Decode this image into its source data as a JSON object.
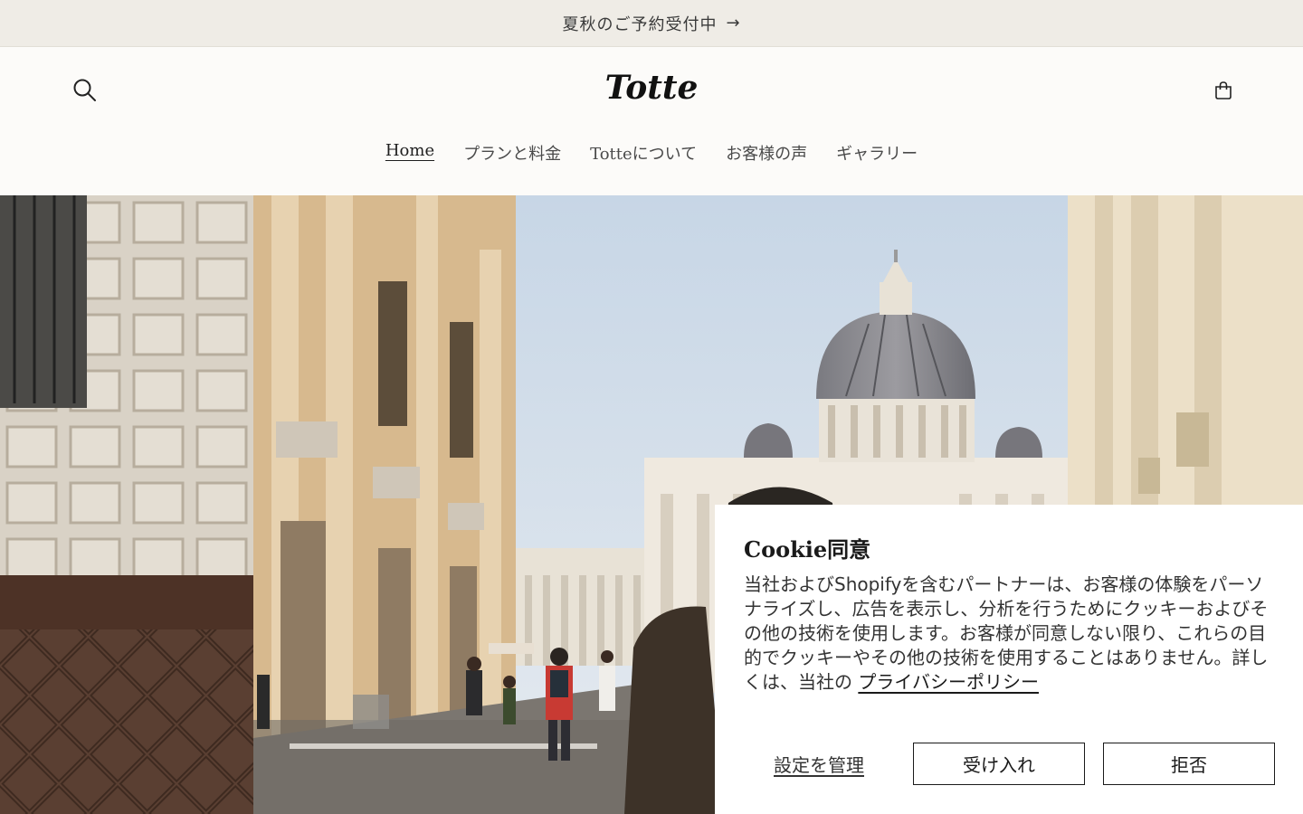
{
  "announcement": {
    "text": "夏秋のご予約受付中",
    "arrow": "→"
  },
  "header": {
    "logo": "Totte",
    "search_icon": "search-icon",
    "cart_icon": "cart-icon"
  },
  "nav": {
    "items": [
      {
        "label": "Home",
        "active": true
      },
      {
        "label": "プランと料金"
      },
      {
        "label": "Totteについて"
      },
      {
        "label": "お客様の声"
      },
      {
        "label": "ギャラリー"
      }
    ]
  },
  "hero": {
    "image": "St. Peter's Basilica dome viewed from a street in Rome with pedestrians"
  },
  "cookie": {
    "title": "Cookie同意",
    "body": "当社およびShopifyを含むパートナーは、お客様の体験をパーソナライズし、広告を表示し、分析を行うためにクッキーおよびその他の技術を使用します。お客様が同意しない限り、これらの目的でクッキーやその他の技術を使用することはありません。詳しくは、当社の",
    "link": "プライバシーポリシー",
    "manage_label": "設定を管理",
    "accept_label": "受け入れ",
    "reject_label": "拒否"
  },
  "colors": {
    "announcement_bg": "#efece6",
    "page_bg": "#fcfbf9",
    "text": "#2b2b2b"
  }
}
